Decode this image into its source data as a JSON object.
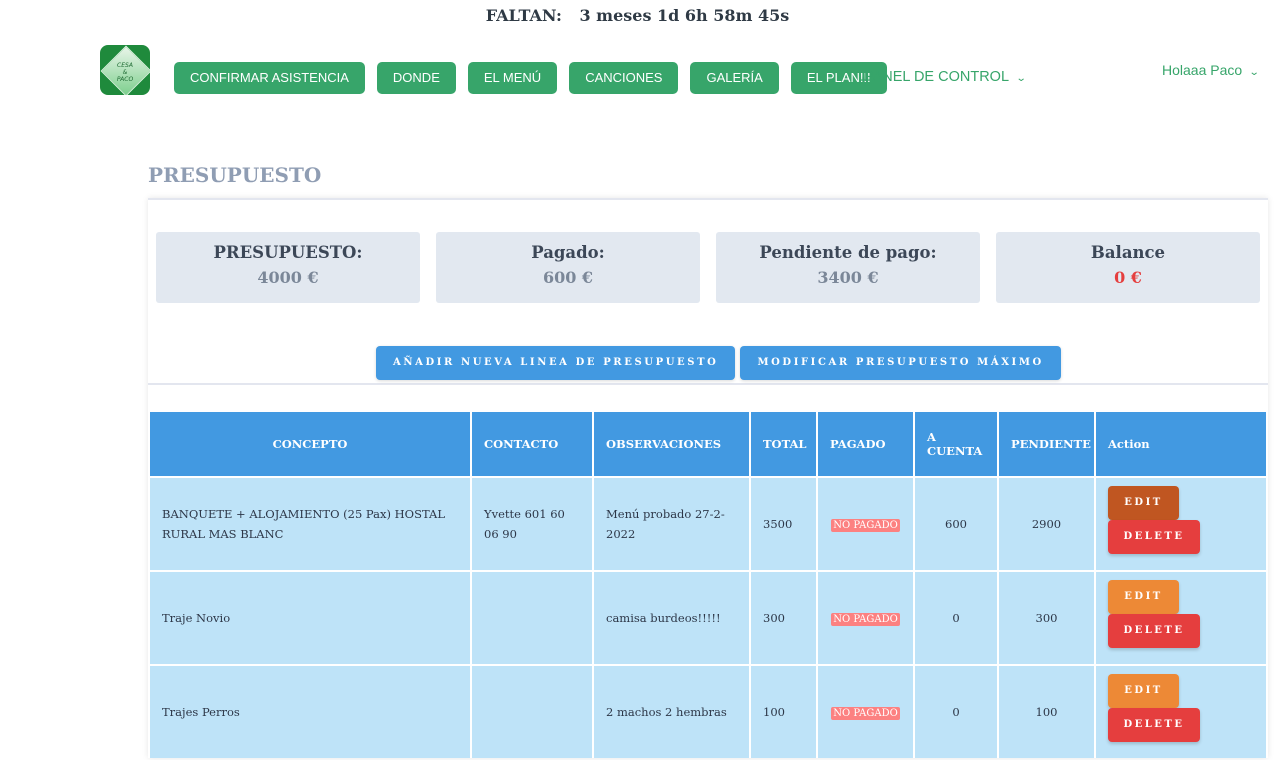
{
  "countdown": {
    "label": "FALTAN:",
    "value": "3 meses 1d 6h 58m 45s"
  },
  "logo": {
    "text_top": "CESA",
    "text_mid": "&",
    "text_bottom": "PACO"
  },
  "nav": {
    "items": [
      "CONFIRMAR ASISTENCIA",
      "DONDE",
      "EL MENÚ",
      "CANCIONES",
      "GALERÍA",
      "EL PLAN!!!"
    ],
    "panel_label": "PANEL DE CONTROL",
    "user_label": "Holaaa Paco"
  },
  "page": {
    "title": "PRESUPUESTO"
  },
  "summary": [
    {
      "label": "PRESUPUESTO:",
      "value": "4000 €"
    },
    {
      "label": "Pagado:",
      "value": "600 €"
    },
    {
      "label": "Pendiente de pago:",
      "value": "3400 €"
    },
    {
      "label": "Balance",
      "value": "0 €"
    }
  ],
  "actions": {
    "add_line": "AÑADIR NUEVA LINEA DE PRESUPUESTO",
    "modify_max": "MODIFICAR PRESUPUESTO MÁXIMO"
  },
  "table": {
    "headers": [
      "CONCEPTO",
      "CONTACTO",
      "OBSERVACIONES",
      "TOTAL",
      "PAGADO",
      "A CUENTA",
      "PENDIENTE",
      "Action"
    ],
    "rows": [
      {
        "concepto": "BANQUETE + ALOJAMIENTO (25 Pax) HOSTAL RURAL MAS BLANC",
        "contacto": "Yvette 601 60 06 90",
        "observaciones": "Menú probado 27-2-2022",
        "total": "3500",
        "pagado": "NO PAGADO",
        "a_cuenta": "600",
        "pendiente": "2900",
        "edit": "EDIT",
        "delete": "DELETE"
      },
      {
        "concepto": "Traje Novio",
        "contacto": "",
        "observaciones": "camisa burdeos!!!!!",
        "total": "300",
        "pagado": "NO PAGADO",
        "a_cuenta": "0",
        "pendiente": "300",
        "edit": "EDIT",
        "delete": "DELETE"
      },
      {
        "concepto": "Trajes Perros",
        "contacto": "",
        "observaciones": "2 machos 2 hembras",
        "total": "100",
        "pagado": "NO PAGADO",
        "a_cuenta": "0",
        "pendiente": "100",
        "edit": "EDIT",
        "delete": "DELETE"
      }
    ]
  },
  "colors": {
    "nav_green": "#37a56a",
    "header_blue": "#4299e1",
    "row_blue": "#bee3f8",
    "edit_orange": "#ed8936",
    "delete_red": "#e53e3e",
    "badge_red": "#fc8181"
  },
  "icons": {
    "panel_chevron": "chevron-down-icon",
    "user_chevron": "chevron-down-icon"
  }
}
